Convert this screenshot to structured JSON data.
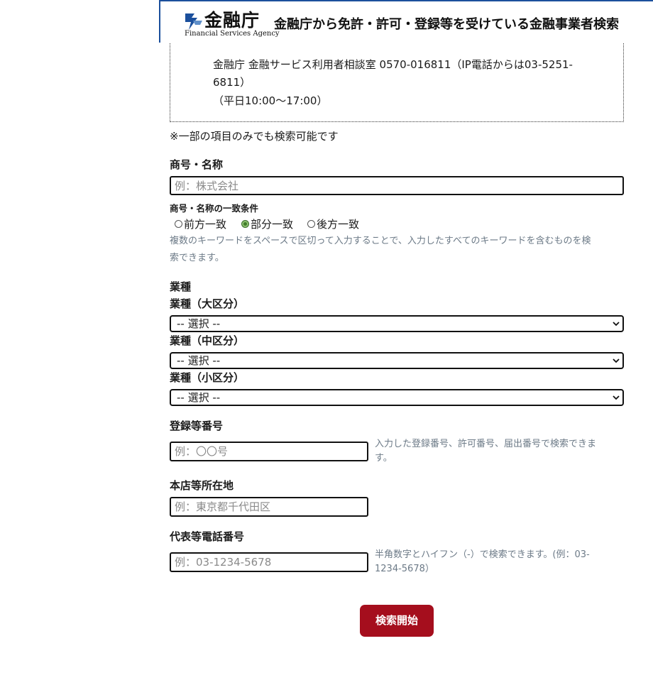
{
  "header": {
    "logo_jp": "金融庁",
    "logo_en": "Financial Services Agency",
    "title": "金融庁から免許・許可・登録等を受けている金融事業者検索"
  },
  "notice": {
    "line1": "金融庁 金融サービス利用者相談室 0570-016811（IP電話からは03-5251-",
    "line2": "6811）",
    "line3": "（平日10:00〜17:00）"
  },
  "note": "※一部の項目のみでも検索可能です",
  "company": {
    "label": "商号・名称",
    "placeholder": "例：株式会社",
    "match_label": "商号・名称の一致条件",
    "options": [
      "前方一致",
      "部分一致",
      "後方一致"
    ],
    "selected": "部分一致",
    "help_line1": "複数のキーワードをスペースで区切って入力することで、入力したすべてのキーワードを含むものを検",
    "help_line2": "索できます。"
  },
  "industry": {
    "label": "業種",
    "major_label": "業種（大区分）",
    "major_value": "-- 選択 --",
    "middle_label": "業種（中区分）",
    "middle_value": "-- 選択 --",
    "minor_label": "業種（小区分）",
    "minor_value": "-- 選択 --"
  },
  "registration": {
    "label": "登録等番号",
    "placeholder": "例：〇〇号",
    "help_line1": "入力した登録番号、許可番号、届出番号で検索できま",
    "help_line2": "す。"
  },
  "address": {
    "label": "本店等所在地",
    "placeholder": "例：東京都千代田区"
  },
  "phone": {
    "label": "代表等電話番号",
    "placeholder": "例：03-1234-5678",
    "help_line1": "半角数字とハイフン（-）で検索できます。(例：03-",
    "help_line2": "1234-5678）"
  },
  "search_button": "検索開始",
  "colors": {
    "header_border": "#1b4f9c",
    "button": "#a50e1d",
    "help_text": "#6c7a87"
  }
}
